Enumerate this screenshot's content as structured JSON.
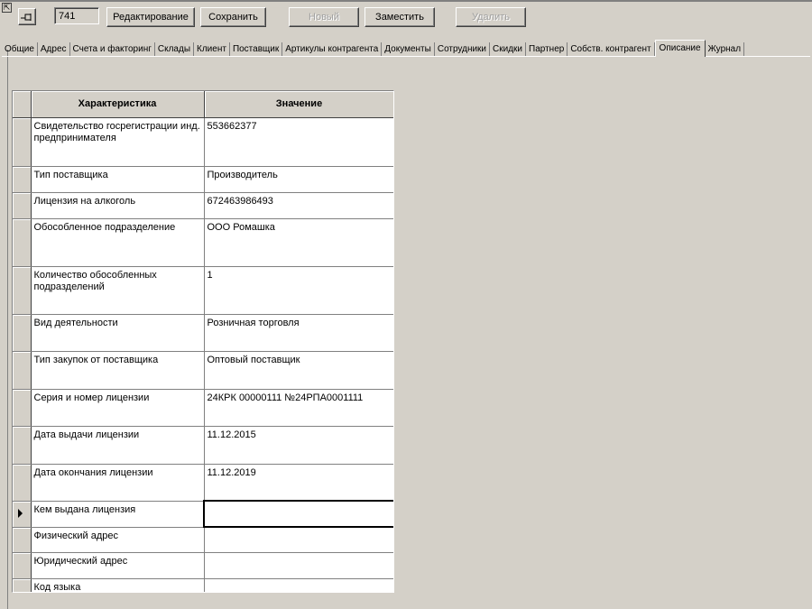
{
  "toolbar": {
    "record_id": "741",
    "edit_label": "Редактирование",
    "save_label": "Сохранить",
    "new_label": "Новый",
    "replace_label": "Заместить",
    "delete_label": "Удалить"
  },
  "tabs": [
    {
      "label": "Общие"
    },
    {
      "label": "Адрес"
    },
    {
      "label": "Счета и факторинг"
    },
    {
      "label": "Склады"
    },
    {
      "label": "Клиент"
    },
    {
      "label": "Поставщик"
    },
    {
      "label": "Артикулы контрагента"
    },
    {
      "label": "Документы"
    },
    {
      "label": "Сотрудники"
    },
    {
      "label": "Скидки"
    },
    {
      "label": "Партнер"
    },
    {
      "label": "Собств. контрагент"
    },
    {
      "label": "Описание",
      "active": true
    },
    {
      "label": "Журнал"
    }
  ],
  "grid": {
    "headers": {
      "characteristic": "Характеристика",
      "value": "Значение"
    },
    "rows": [
      {
        "name": "Свидетельство госрегистрации инд. предпринимателя",
        "value": "553662377"
      },
      {
        "name": "Тип поставщика",
        "value": "Производитель"
      },
      {
        "name": "Лицензия на алкоголь",
        "value": "672463986493"
      },
      {
        "name": "Обособленное подразделение",
        "value": "ООО Ромашка"
      },
      {
        "name": "Количество обособленных подразделений",
        "value": "1"
      },
      {
        "name": "Вид деятельности",
        "value": "Розничная торговля"
      },
      {
        "name": "Тип закупок от поставщика",
        "value": "Оптовый поставщик"
      },
      {
        "name": "Серия и номер лицензии",
        "value": "24КРК 00000111 №24РПА0001111"
      },
      {
        "name": "Дата выдачи лицензии",
        "value": "11.12.2015"
      },
      {
        "name": "Дата окончания лицензии",
        "value": "11.12.2019"
      },
      {
        "name": "Кем выдана лицензия",
        "value": ""
      },
      {
        "name": "Физический адрес",
        "value": ""
      },
      {
        "name": "Юридический адрес",
        "value": ""
      },
      {
        "name": "Код языка",
        "value": ""
      }
    ]
  },
  "icons": {
    "corner": "restore-icon",
    "pin": "pin-icon",
    "current_row": "row-pointer-icon"
  }
}
